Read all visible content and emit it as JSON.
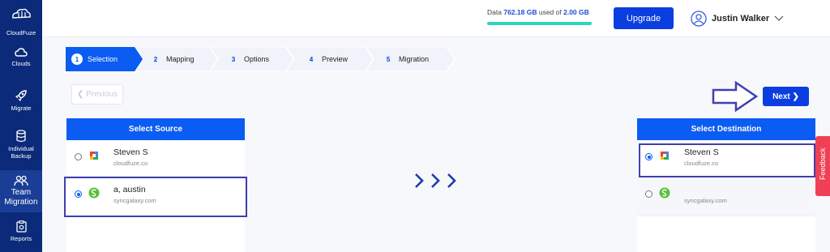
{
  "app": {
    "name": "CloudFuze"
  },
  "sidebar": {
    "items": [
      {
        "label": "Clouds",
        "icon": "cloud-icon"
      },
      {
        "label": "Migrate",
        "icon": "rocket-icon"
      },
      {
        "label": "Individual Backup",
        "line1": "Individual",
        "line2": "Backup",
        "icon": "database-icon"
      },
      {
        "label": "Team Migration",
        "line1": "Team",
        "line2": "Migration",
        "icon": "team-icon",
        "active": true
      },
      {
        "label": "Reports",
        "icon": "reports-icon"
      }
    ]
  },
  "header": {
    "storage_prefix": "Data",
    "storage_used": "762.18 GB",
    "storage_mid": "used of",
    "storage_total": "2.00 GB",
    "storage_fill_fraction": 1.0,
    "upgrade_label": "Upgrade",
    "user_name": "Justin Walker"
  },
  "steps": [
    {
      "num": "1",
      "label": "Selection",
      "active": true
    },
    {
      "num": "2",
      "label": "Mapping"
    },
    {
      "num": "3",
      "label": "Options"
    },
    {
      "num": "4",
      "label": "Preview"
    },
    {
      "num": "5",
      "label": "Migration"
    }
  ],
  "nav": {
    "previous_label": "Previous",
    "next_label": "Next"
  },
  "source": {
    "title": "Select Source",
    "accounts": [
      {
        "name": "Steven S",
        "domain": "cloudfuze.co",
        "logo": "workspace-logo-icon",
        "selected": false
      },
      {
        "name": "a, austin",
        "domain": "syncgalaxy.com",
        "logo": "sharefile-logo-icon",
        "selected": true
      }
    ]
  },
  "destination": {
    "title": "Select Destination",
    "accounts": [
      {
        "name": "Steven S",
        "domain": "cloudfuze.co",
        "logo": "workspace-logo-icon",
        "selected": true
      },
      {
        "name": "",
        "domain": "syncgalaxy.com",
        "logo": "sharefile-logo-icon",
        "selected": false
      }
    ]
  },
  "feedback_label": "Feedback",
  "colors": {
    "sidebar": "#0b2a7a",
    "primary": "#0b3ee0",
    "panel_header": "#0b5cf2",
    "storage_bar": "#2dd4bf",
    "feedback": "#ef4055"
  }
}
